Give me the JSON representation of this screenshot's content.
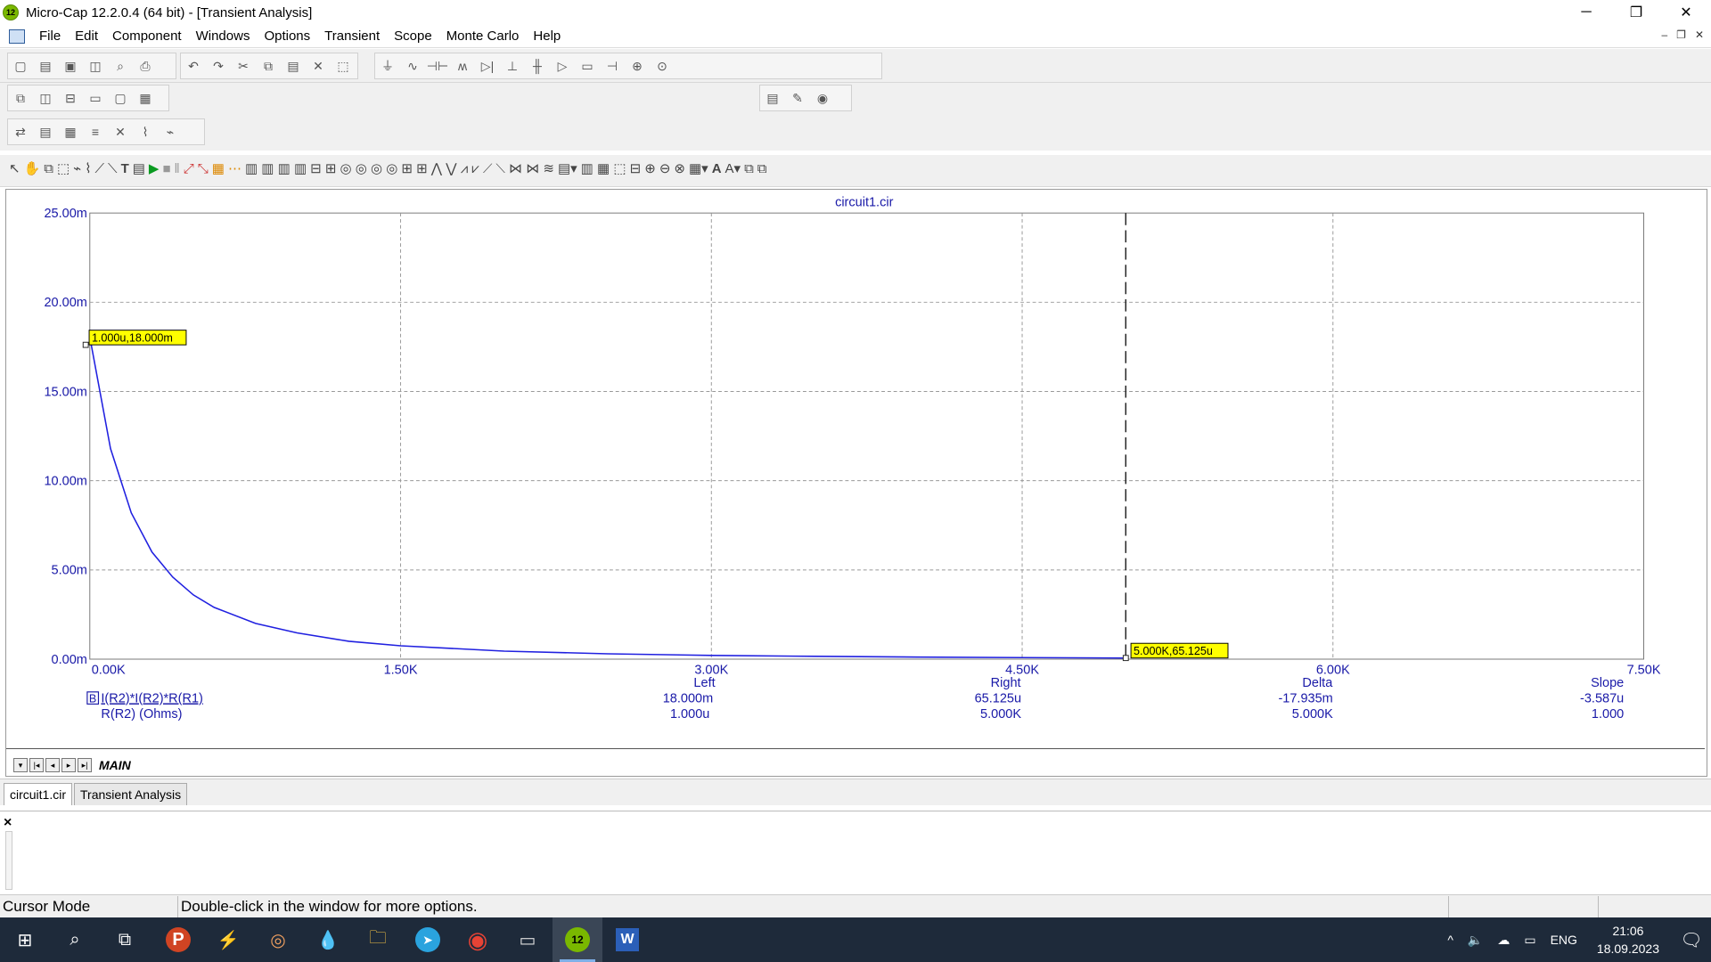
{
  "window": {
    "title": "Micro-Cap 12.2.0.4 (64 bit) - [Transient Analysis]",
    "app_icon_text": "12",
    "minimize": "─",
    "restore": "❐",
    "close": "✕"
  },
  "menu": {
    "items": [
      "File",
      "Edit",
      "Component",
      "Windows",
      "Options",
      "Transient",
      "Scope",
      "Monte Carlo",
      "Help"
    ],
    "mdi_minimize": "–",
    "mdi_restore": "❐",
    "mdi_close": "✕"
  },
  "colors": {
    "curve": "#2020e0",
    "axis_label": "#1a1aa8",
    "tag_bg": "#ffff00",
    "grid": "#999999"
  },
  "chart_data": {
    "type": "line",
    "title": "circuit1.cir",
    "x_ticks": [
      "0.00K",
      "1.50K",
      "3.00K",
      "4.50K",
      "6.00K",
      "7.50K"
    ],
    "y_ticks": [
      "0.00m",
      "5.00m",
      "10.00m",
      "15.00m",
      "20.00m",
      "25.00m"
    ],
    "xlim": [
      0,
      7500
    ],
    "ylim": [
      0,
      0.025
    ],
    "grid": true,
    "series": [
      {
        "name": "I(R2)*I(R2)*R(R1)",
        "x": [
          1,
          100,
          200,
          300,
          400,
          500,
          600,
          800,
          1000,
          1250,
          1500,
          2000,
          2500,
          3000,
          3500,
          4000,
          4500,
          5000
        ],
        "y": [
          0.018,
          0.0118,
          0.0082,
          0.006,
          0.0046,
          0.0036,
          0.0029,
          0.002,
          0.00147,
          0.001,
          0.00075,
          0.00045,
          0.0003,
          0.00021,
          0.00016,
          0.000115,
          8.5e-05,
          6.5125e-05
        ]
      }
    ],
    "cursor_left": {
      "x": 1,
      "y": 0.018,
      "label": "1.000u,18.000m"
    },
    "cursor_right": {
      "x": 5000,
      "y": 6.5125e-05,
      "label": "5.000K,65.125u"
    }
  },
  "readout": {
    "headers": {
      "left": "Left",
      "right": "Right",
      "delta": "Delta",
      "slope": "Slope"
    },
    "expr_row": {
      "box": "B",
      "label": "I(R2)*I(R2)*R(R1)",
      "left": "18.000m",
      "right": "65.125u",
      "delta": "-17.935m",
      "slope": "-3.587u"
    },
    "x_row": {
      "label": "R(R2) (Ohms)",
      "left": "1.000u",
      "right": "5.000K",
      "delta": "5.000K",
      "slope": "1.000"
    }
  },
  "page_tabs": {
    "main": "MAIN"
  },
  "doc_tabs": [
    "circuit1.cir",
    "Transient Analysis"
  ],
  "output": {
    "close": "×"
  },
  "status": {
    "mode": "Cursor Mode",
    "hint": "Double-click in the window for more options."
  },
  "taskbar": {
    "start": "⊞",
    "search": "⌕",
    "taskview": "⧉",
    "apps": [
      {
        "name": "powerpoint",
        "glyph": "P"
      },
      {
        "name": "app-green",
        "glyph": "⚡"
      },
      {
        "name": "app-disc",
        "glyph": "◎"
      },
      {
        "name": "app-drop",
        "glyph": "💧"
      },
      {
        "name": "explorer",
        "glyph": "🗀"
      },
      {
        "name": "telegram",
        "glyph": "➤"
      },
      {
        "name": "chrome",
        "glyph": "◉"
      },
      {
        "name": "terminal",
        "glyph": "▭"
      },
      {
        "name": "microcap",
        "glyph": "12"
      },
      {
        "name": "word",
        "glyph": "W"
      }
    ],
    "tray_chevron": "^",
    "volume": "🔈",
    "cloud": "☁",
    "battery": "▭",
    "lang": "ENG",
    "time": "21:06",
    "date": "18.09.2023",
    "notifications": "🗨"
  }
}
